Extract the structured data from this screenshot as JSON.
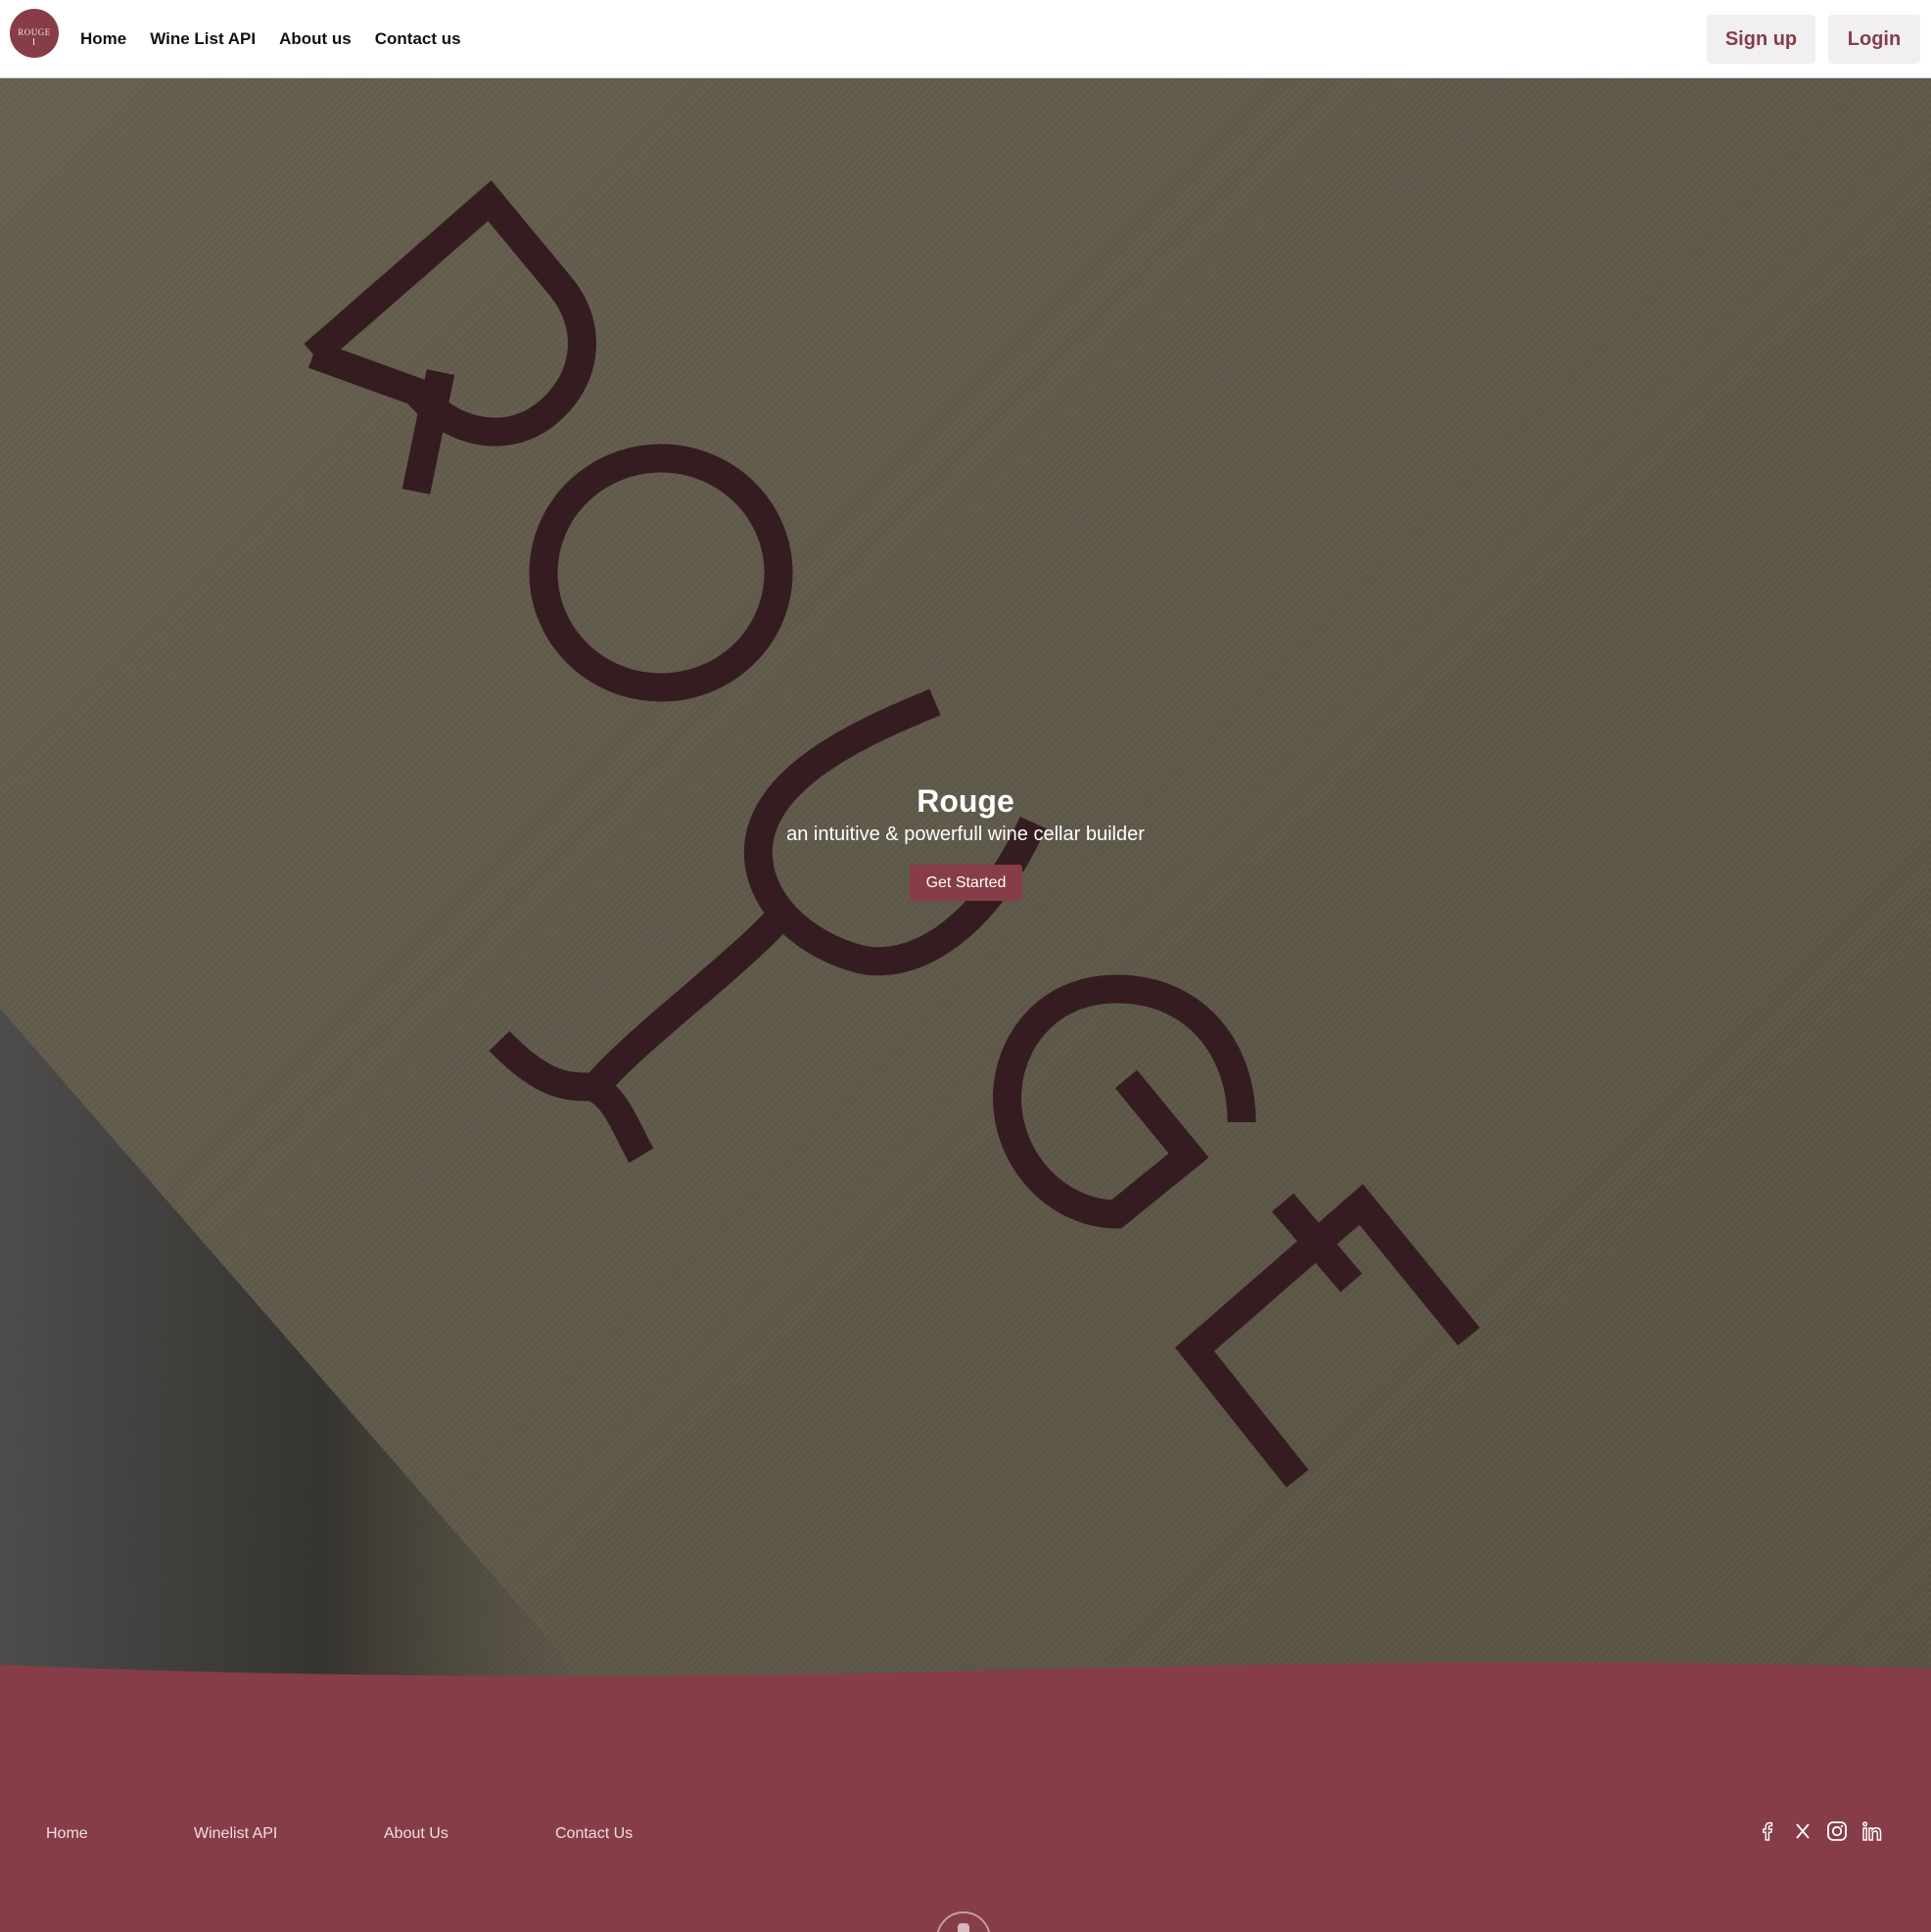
{
  "header": {
    "logo_text": "ROUGE",
    "nav": [
      {
        "label": "Home"
      },
      {
        "label": "Wine List API"
      },
      {
        "label": "About us"
      },
      {
        "label": "Contact us"
      }
    ],
    "signup_label": "Sign up",
    "login_label": "Login"
  },
  "hero": {
    "watermark_letters": [
      "R",
      "O",
      "U",
      "G",
      "E"
    ],
    "title": "Rouge",
    "subtitle": "an intuitive & powerfull wine cellar builder",
    "cta_label": "Get Started"
  },
  "footer": {
    "links": [
      {
        "label": "Home"
      },
      {
        "label": "Winelist API"
      },
      {
        "label": "About Us"
      },
      {
        "label": "Contact Us"
      }
    ],
    "social_icons": [
      "facebook-icon",
      "x-icon",
      "instagram-icon",
      "linkedin-icon"
    ]
  },
  "colors": {
    "brand": "#863d47",
    "logo_dark": "#351c20",
    "hero_bg": "#605a4b",
    "button_bg": "#f1eff1"
  }
}
